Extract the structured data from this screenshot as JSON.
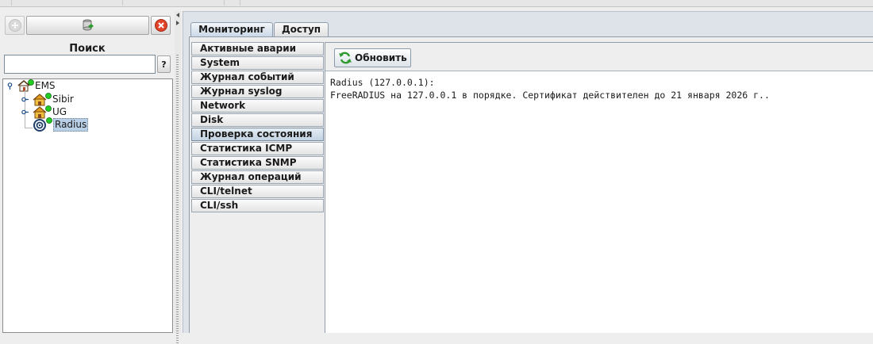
{
  "left_panel": {
    "search_label": "Поиск",
    "search_value": "",
    "help_label": "?",
    "tree": {
      "root": {
        "label": "EMS",
        "status_color": "#22cc22"
      },
      "children": [
        {
          "label": "Sibir",
          "status_color": "#22cc22",
          "icon": "house-icon"
        },
        {
          "label": "UG",
          "status_color": "#22cc22",
          "icon": "house-icon"
        },
        {
          "label": "Radius",
          "status_color": "#22cc22",
          "icon": "target-icon",
          "selected": true
        }
      ]
    }
  },
  "tabs": [
    {
      "label": "Мониторинг",
      "active": true
    },
    {
      "label": "Доступ",
      "active": false
    }
  ],
  "subtabs": [
    {
      "label": "Активные аварии"
    },
    {
      "label": "System"
    },
    {
      "label": "Журнал событий"
    },
    {
      "label": "Журнал syslog"
    },
    {
      "label": "Network"
    },
    {
      "label": "Disk"
    },
    {
      "label": "Проверка состояния",
      "active": true
    },
    {
      "label": "Статистика ICMP"
    },
    {
      "label": "Статистика SNMP"
    },
    {
      "label": "Журнал операций"
    },
    {
      "label": "CLI/telnet"
    },
    {
      "label": "CLI/ssh"
    }
  ],
  "toolbar": {
    "refresh_label": "Обновить"
  },
  "output": {
    "lines": [
      "Radius (127.0.0.1):",
      "FreeRADIUS на 127.0.0.1 в порядке. Сертификат действителен до 21 января 2026 г.."
    ]
  },
  "colors": {
    "accent": "#b8cfe5",
    "status_ok": "#22cc22",
    "close_red": "#e0452a",
    "refresh_green": "#2f9a2f"
  }
}
